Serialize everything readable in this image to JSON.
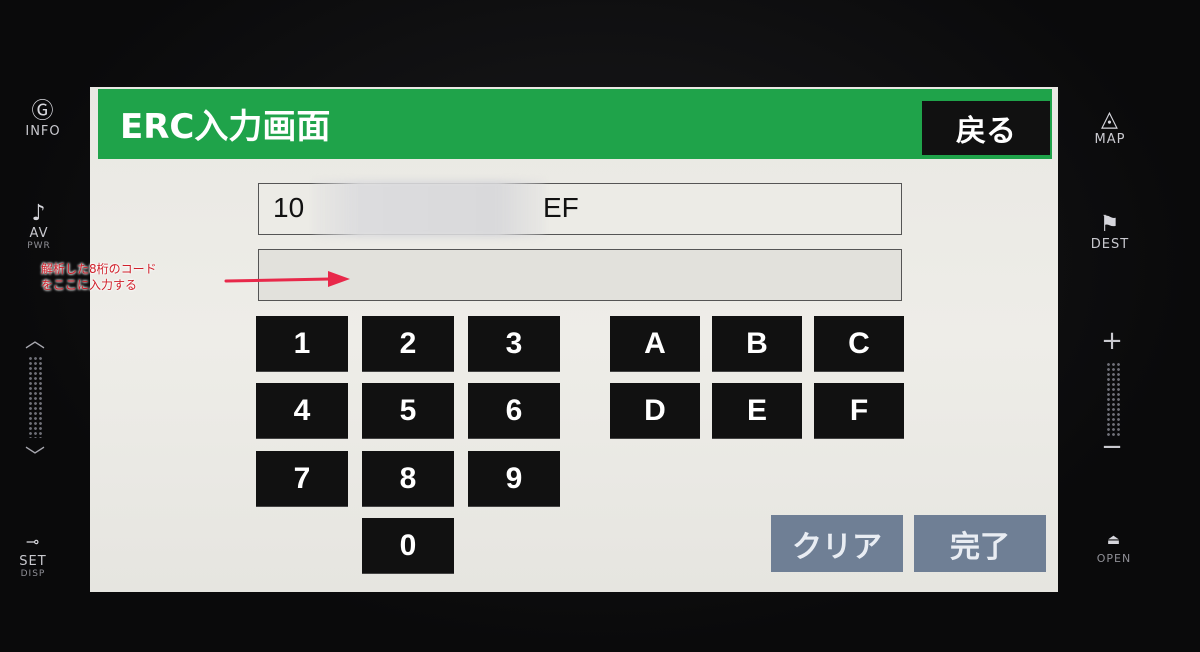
{
  "screen": {
    "title": "ERC入力画面",
    "back_label": "戻る",
    "code_field": {
      "prefix": "10",
      "suffix": "EF"
    },
    "input_field": {
      "value": ""
    }
  },
  "keypad": {
    "digits": [
      "1",
      "2",
      "3",
      "4",
      "5",
      "6",
      "7",
      "8",
      "9",
      "0"
    ],
    "letters": [
      "A",
      "B",
      "C",
      "D",
      "E",
      "F"
    ],
    "clear_label": "クリア",
    "done_label": "完了"
  },
  "annotation": {
    "line1": "解析した8桁のコード",
    "line2": "をここに入力する"
  },
  "hardware": {
    "left": {
      "info": "INFO",
      "av": "AV",
      "pwr": "PWR",
      "set": "SET",
      "disp": "DISP"
    },
    "right": {
      "map": "MAP",
      "dest": "DEST",
      "open": "OPEN"
    }
  },
  "colors": {
    "titlebar": "#1fa34a",
    "key": "#111111",
    "action": "#6f7f95",
    "annotation": "#d0202b"
  }
}
